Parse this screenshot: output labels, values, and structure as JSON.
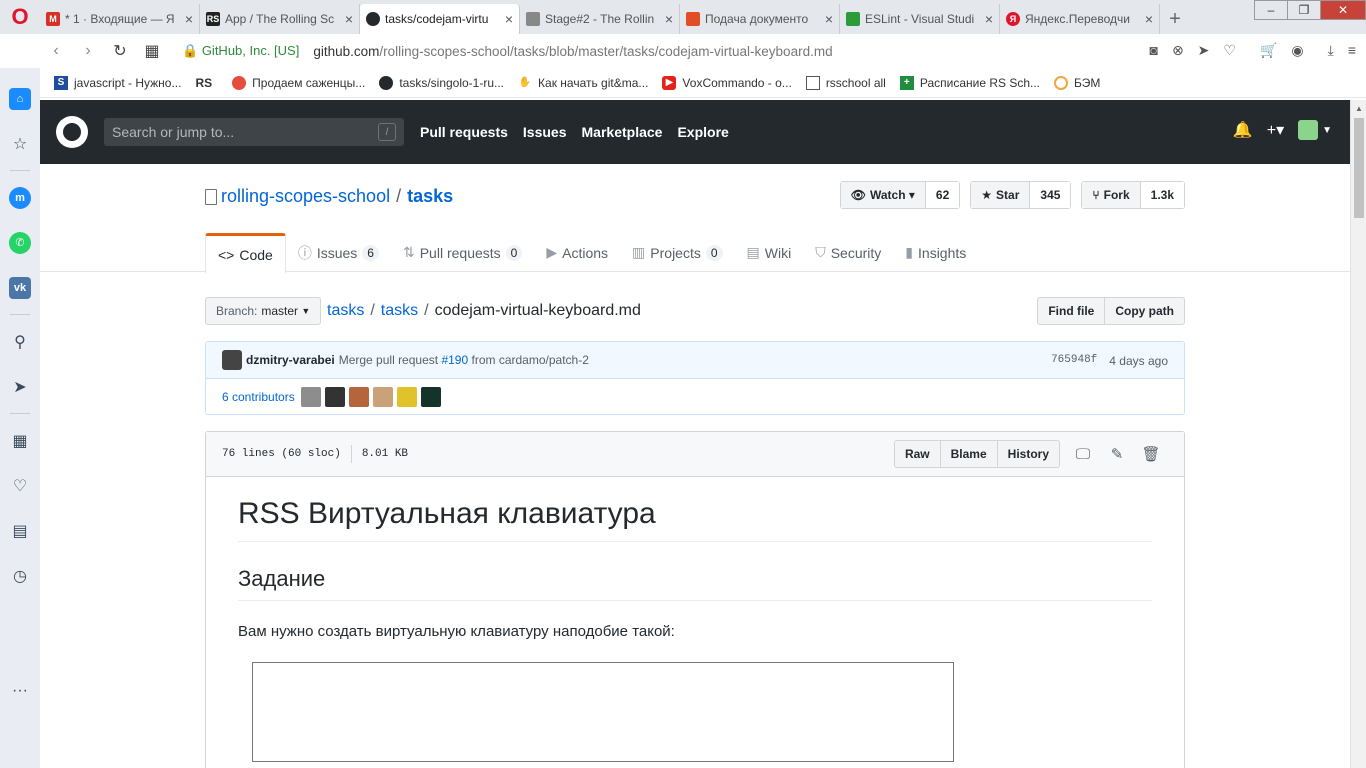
{
  "browser": {
    "tabs": [
      {
        "label": "* 1 · Входящие — Я",
        "fav": "gmail",
        "color": "#d93025",
        "active": false
      },
      {
        "label": "App / The Rolling Sc",
        "fav": "RS",
        "color": "#222222",
        "active": false
      },
      {
        "label": "tasks/codejam-virtu",
        "fav": "gh",
        "color": "#24292e",
        "active": true
      },
      {
        "label": "Stage#2 - The Rollin",
        "fav": "doc",
        "color": "#888888",
        "active": false
      },
      {
        "label": "Подача документо",
        "fav": "doc",
        "color": "#e34d26",
        "active": false
      },
      {
        "label": "ESLint - Visual Studi",
        "fav": "ms",
        "color": "#2a9d3a",
        "active": false
      },
      {
        "label": "Яндекс.Переводчи",
        "fav": "ya",
        "color": "#e0142b",
        "active": false
      }
    ],
    "secure_label": "GitHub, Inc. [US]",
    "url_host": "github.com",
    "url_path": "/rolling-scopes-school/tasks/blob/master/tasks/codejam-virtual-keyboard.md",
    "bookmarks": [
      {
        "label": "javascript - Нужно..."
      },
      {
        "label": "RS"
      },
      {
        "label": "Продаем саженцы..."
      },
      {
        "label": "tasks/singolo-1-ru..."
      },
      {
        "label": "Как начать git&ma..."
      },
      {
        "label": "VoxCommando - o..."
      },
      {
        "label": "rsschool all"
      },
      {
        "label": "Расписание RS Sch..."
      },
      {
        "label": "БЭМ"
      }
    ]
  },
  "github": {
    "search_placeholder": "Search or jump to...",
    "search_key": "/",
    "nav": [
      "Pull requests",
      "Issues",
      "Marketplace",
      "Explore"
    ],
    "repo_owner": "rolling-scopes-school",
    "repo_name": "tasks",
    "watch": {
      "label": "Watch",
      "count": "62"
    },
    "star": {
      "label": "Star",
      "count": "345"
    },
    "fork": {
      "label": "Fork",
      "count": "1.3k"
    },
    "tabs": [
      {
        "label": "Code",
        "counter": ""
      },
      {
        "label": "Issues",
        "counter": "6"
      },
      {
        "label": "Pull requests",
        "counter": "0"
      },
      {
        "label": "Actions",
        "counter": ""
      },
      {
        "label": "Projects",
        "counter": "0"
      },
      {
        "label": "Wiki",
        "counter": ""
      },
      {
        "label": "Security",
        "counter": ""
      },
      {
        "label": "Insights",
        "counter": ""
      }
    ],
    "branch_prefix": "Branch:",
    "branch": "master",
    "breadcrumb": {
      "root": "tasks",
      "dir": "tasks",
      "file": "codejam-virtual-keyboard.md"
    },
    "find_file": "Find file",
    "copy_path": "Copy path",
    "commit": {
      "author": "dzmitry-varabei",
      "msg_prefix": "Merge pull request",
      "pr": "#190",
      "msg_suffix": "from cardamo/patch-2",
      "sha": "765948f",
      "time": "4 days ago"
    },
    "contributors_label": "6 contributors",
    "file_info": {
      "lines": "76 lines (60 sloc)",
      "size": "8.01 KB"
    },
    "file_buttons": {
      "raw": "Raw",
      "blame": "Blame",
      "history": "History"
    }
  },
  "content": {
    "h1": "RSS Виртуальная клавиатура",
    "h2": "Задание",
    "p1": "Вам нужно создать виртуальную клавиатуру наподобие такой:"
  },
  "colors": {
    "accent": "#0366d6",
    "header": "#24292e",
    "selected_tab": "#e36209"
  }
}
